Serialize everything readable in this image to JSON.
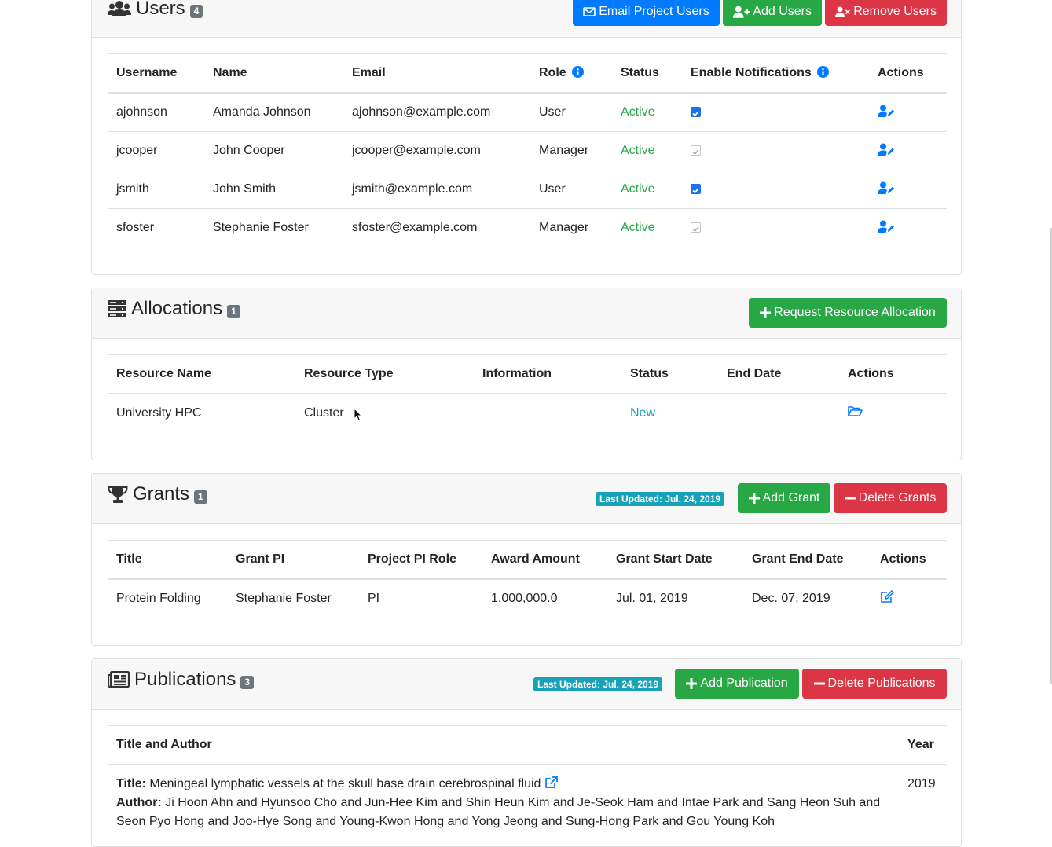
{
  "users": {
    "title": "Users",
    "count": "4",
    "buttons": {
      "email": "Email Project Users",
      "add": "Add Users",
      "remove": "Remove Users"
    },
    "columns": [
      "Username",
      "Name",
      "Email",
      "Role",
      "Status",
      "Enable Notifications",
      "Actions"
    ],
    "rows": [
      {
        "username": "ajohnson",
        "name": "Amanda Johnson",
        "email": "ajohnson@example.com",
        "role": "User",
        "status": "Active",
        "notifications": "checked"
      },
      {
        "username": "jcooper",
        "name": "John Cooper",
        "email": "jcooper@example.com",
        "role": "Manager",
        "status": "Active",
        "notifications": "checked-disabled"
      },
      {
        "username": "jsmith",
        "name": "John Smith",
        "email": "jsmith@example.com",
        "role": "User",
        "status": "Active",
        "notifications": "checked"
      },
      {
        "username": "sfoster",
        "name": "Stephanie Foster",
        "email": "sfoster@example.com",
        "role": "Manager",
        "status": "Active",
        "notifications": "checked-disabled"
      }
    ]
  },
  "allocations": {
    "title": "Allocations",
    "count": "1",
    "request_button": "Request Resource Allocation",
    "columns": [
      "Resource Name",
      "Resource Type",
      "Information",
      "Status",
      "End Date",
      "Actions"
    ],
    "rows": [
      {
        "resource_name": "University HPC",
        "resource_type": "Cluster",
        "information": "",
        "status": "New",
        "end_date": ""
      }
    ]
  },
  "grants": {
    "title": "Grants",
    "count": "1",
    "last_updated": "Last Updated: Jul. 24, 2019",
    "add_button": "Add Grant",
    "delete_button": "Delete Grants",
    "columns": [
      "Title",
      "Grant PI",
      "Project PI Role",
      "Award Amount",
      "Grant Start Date",
      "Grant End Date",
      "Actions"
    ],
    "rows": [
      {
        "title": "Protein Folding",
        "grant_pi": "Stephanie Foster",
        "pi_role": "PI",
        "award_amount": "1,000,000.0",
        "start_date": "Jul. 01, 2019",
        "end_date": "Dec. 07, 2019"
      }
    ]
  },
  "publications": {
    "title": "Publications",
    "count": "3",
    "last_updated": "Last Updated: Jul. 24, 2019",
    "add_button": "Add Publication",
    "delete_button": "Delete Publications",
    "columns": [
      "Title and Author",
      "Year"
    ],
    "title_label": "Title:",
    "author_label": "Author:",
    "rows": [
      {
        "title": "Meningeal lymphatic vessels at the skull base drain cerebrospinal fluid",
        "author": "Ji Hoon Ahn and Hyunsoo Cho and Jun-Hee Kim and Shin Heun Kim and Je-Seok Ham and Intae Park and Sang Heon Suh and Seon Pyo Hong and Joo-Hye Song and Young-Kwon Hong and Yong Jeong and Sung-Hong Park and Gou Young Koh",
        "year": "2019"
      }
    ]
  },
  "colors": {
    "primary": "#007bff",
    "success": "#28a745",
    "danger": "#dc3545",
    "info": "#17a2b8",
    "secondary": "#6c757d"
  },
  "icons": {
    "users_section": "users-icon",
    "allocations_section": "server-icon",
    "grants_section": "trophy-icon",
    "publications_section": "newspaper-icon",
    "user_action": "user-edit-icon",
    "allocation_action": "folder-open-icon",
    "grant_action": "edit-icon",
    "publication_link": "external-link-icon"
  }
}
